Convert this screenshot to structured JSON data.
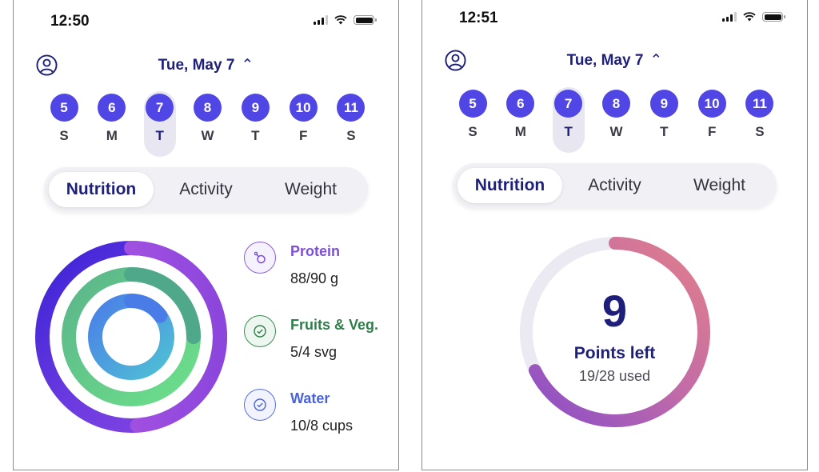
{
  "screens": [
    {
      "status_bar": {
        "time": "12:50"
      },
      "header": {
        "date": "Tue, May 7",
        "chevron_icon": "chevron-up-icon",
        "profile_icon": "profile-icon"
      },
      "week": {
        "selected_index": 2,
        "days": [
          {
            "num": "5",
            "letter": "S"
          },
          {
            "num": "6",
            "letter": "M"
          },
          {
            "num": "7",
            "letter": "T"
          },
          {
            "num": "8",
            "letter": "W"
          },
          {
            "num": "9",
            "letter": "T"
          },
          {
            "num": "10",
            "letter": "F"
          },
          {
            "num": "11",
            "letter": "S"
          }
        ]
      },
      "tabs": [
        {
          "label": "Nutrition",
          "active": true
        },
        {
          "label": "Activity",
          "active": false
        },
        {
          "label": "Weight",
          "active": false
        }
      ],
      "nutrition": {
        "items": [
          {
            "title": "Protein",
            "value": "88/90 g",
            "icon": "drumstick-icon",
            "color": "#7b4fd8",
            "current": 88,
            "goal": 90
          },
          {
            "title": "Fruits & Veg.",
            "value": "5/4 svg",
            "icon": "check-circle-icon",
            "color": "#2e7d4a",
            "current": 5,
            "goal": 4
          },
          {
            "title": "Water",
            "value": "10/8 cups",
            "icon": "check-circle-icon",
            "color": "#4a63d8",
            "current": 10,
            "goal": 8
          }
        ]
      }
    },
    {
      "status_bar": {
        "time": "12:51"
      },
      "header": {
        "date": "Tue, May 7",
        "chevron_icon": "chevron-up-icon",
        "profile_icon": "profile-icon"
      },
      "week": {
        "selected_index": 2,
        "days": [
          {
            "num": "5",
            "letter": "S"
          },
          {
            "num": "6",
            "letter": "M"
          },
          {
            "num": "7",
            "letter": "T"
          },
          {
            "num": "8",
            "letter": "W"
          },
          {
            "num": "9",
            "letter": "T"
          },
          {
            "num": "10",
            "letter": "F"
          },
          {
            "num": "11",
            "letter": "S"
          }
        ]
      },
      "tabs": [
        {
          "label": "Nutrition",
          "active": true
        },
        {
          "label": "Activity",
          "active": false
        },
        {
          "label": "Weight",
          "active": false
        }
      ],
      "points": {
        "left": "9",
        "label": "Points left",
        "used_text": "19/28 used",
        "used": 19,
        "total": 28
      }
    }
  ]
}
